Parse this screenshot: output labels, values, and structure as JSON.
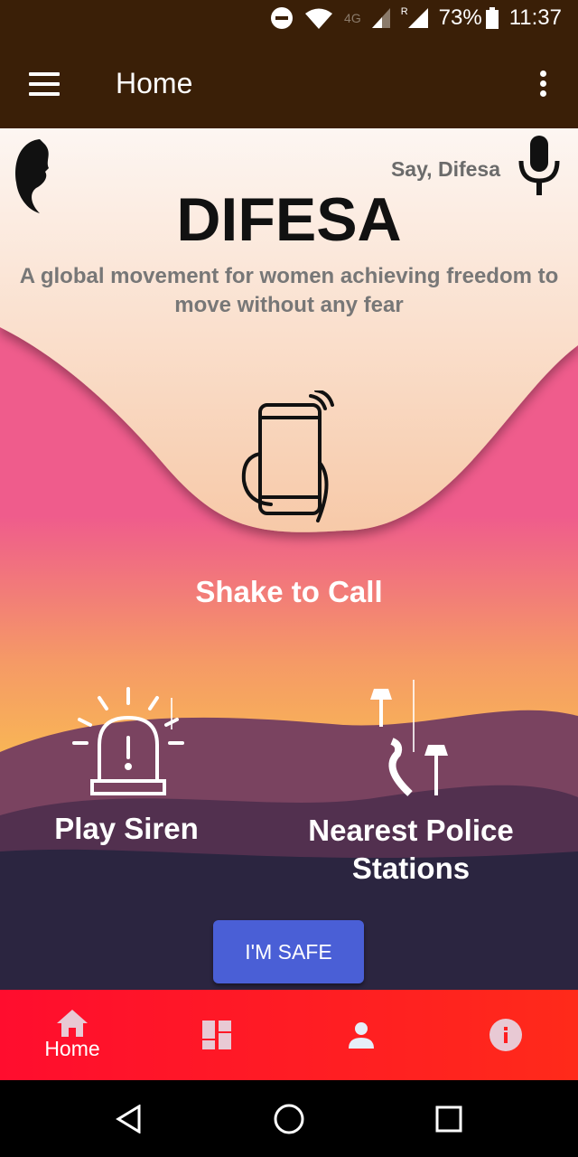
{
  "status_bar": {
    "network": "4G",
    "roaming": "R",
    "battery": "73%",
    "time": "11:37"
  },
  "app_bar": {
    "title": "Home"
  },
  "header": {
    "voice_prompt": "Say, Difesa",
    "brand": "DIFESA",
    "tagline": "A global movement for women achieving freedom to move without any fear"
  },
  "actions": {
    "shake": "Shake to Call",
    "siren": "Play Siren",
    "police": "Nearest Police Stations",
    "safe": "I'M SAFE"
  },
  "bottom_nav": {
    "items": [
      {
        "label": "Home",
        "icon": "home-icon"
      },
      {
        "icon": "dashboard-icon"
      },
      {
        "icon": "person-icon"
      },
      {
        "icon": "info-icon"
      }
    ]
  },
  "colors": {
    "app_bar": "#3a1f07",
    "accent": "#4a5fd6",
    "nav": "#ff0d2e"
  }
}
